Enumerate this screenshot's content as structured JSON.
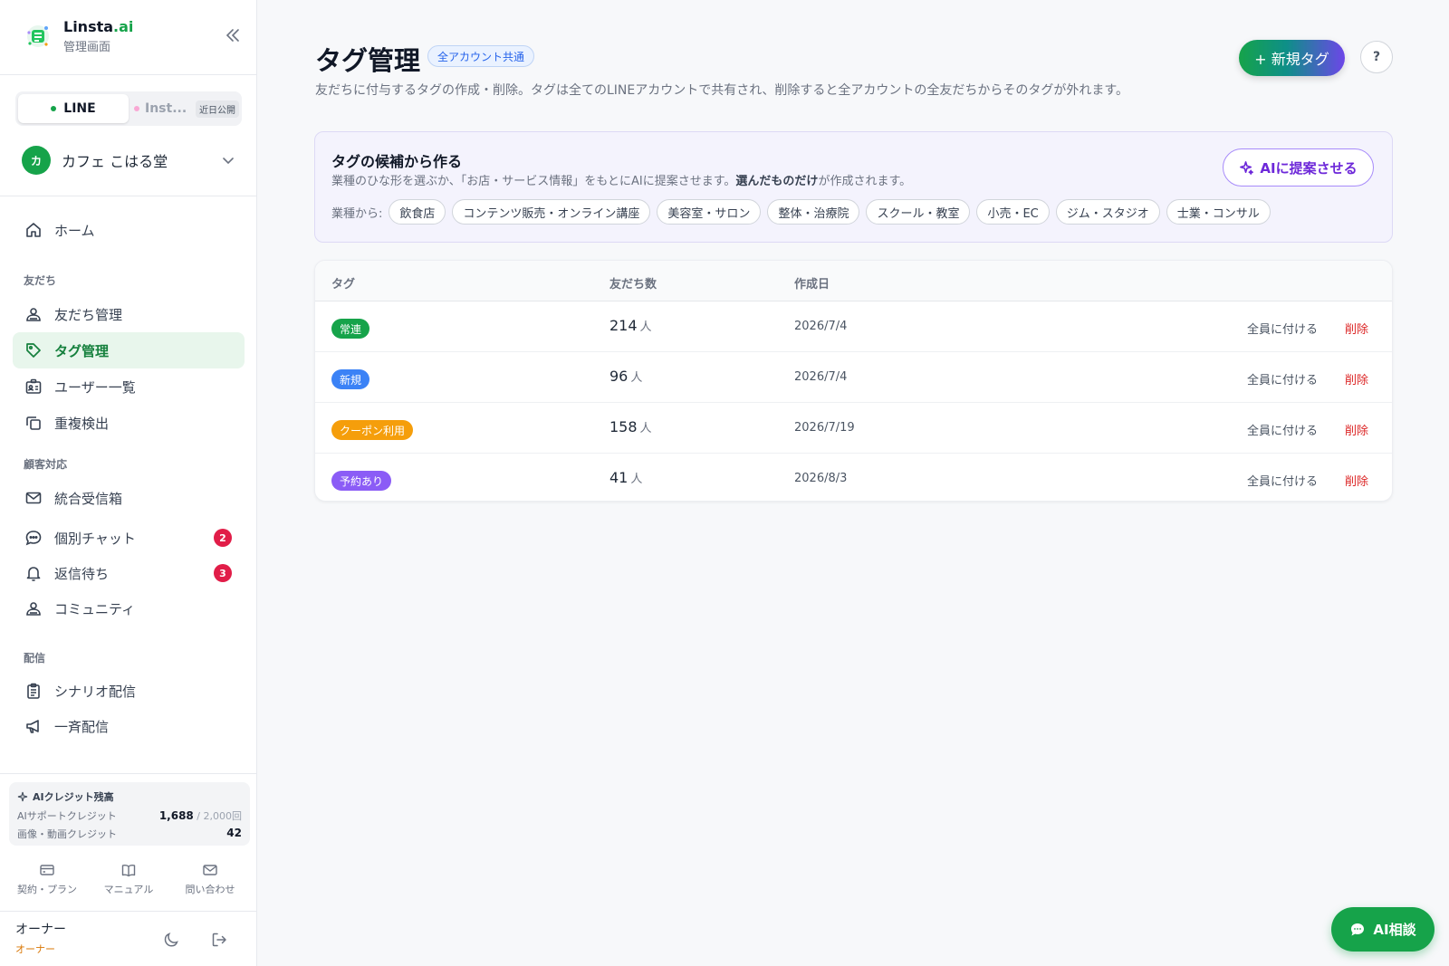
{
  "sidebar": {
    "brand": {
      "name_prefix": "Linsta",
      "name_suffix": ".ai",
      "subtitle": "管理画面"
    },
    "channels": [
      {
        "label": "LINE",
        "status_color": "#16a34a",
        "active": true
      },
      {
        "label": "Inst...",
        "status_color": "#f9a8d4",
        "badge": "近日公開"
      }
    ],
    "account": {
      "avatar": "カ",
      "name": "カフェ こはる堂"
    },
    "nav": {
      "home": "ホーム",
      "section_friends": "友だち",
      "friends_manage": "友だち管理",
      "tag_manage": "タグ管理",
      "user_list": "ユーザー一覧",
      "duplicate_detect": "重複検出",
      "section_support": "顧客対応",
      "unified_inbox": "統合受信箱",
      "private_chat": "個別チャット",
      "private_chat_badge": "2",
      "awaiting_reply": "返信待ち",
      "awaiting_reply_badge": "3",
      "community": "コミュニティ",
      "section_delivery": "配信",
      "scenario_delivery": "シナリオ配信",
      "broadcast": "一斉配信"
    },
    "credits": {
      "title": "AIクレジット残高",
      "support_label": "AIサポートクレジット",
      "support_value": "1,688",
      "support_max": "/ 2,000回",
      "media_label": "画像・動画クレジット",
      "media_value": "42"
    },
    "footer_links": {
      "plan": "契約・プラン",
      "manual": "マニュアル",
      "contact": "問い合わせ"
    },
    "owner": {
      "name": "オーナー",
      "role": "オーナー"
    }
  },
  "main": {
    "title": "タグ管理",
    "scope_badge": "全アカウント共通",
    "description": "友だちに付与するタグの作成・削除。タグは全てのLINEアカウントで共有され、削除すると全アカウントの全友だちからそのタグが外れます。",
    "new_tag_button": "+ 新規タグ",
    "help_button": "?",
    "suggest": {
      "title": "タグの候補から作る",
      "desc_before": "業種のひな形を選ぶか、「お店・サービス情報」をもとにAIに提案させます。",
      "desc_bold": "選んだものだけ",
      "desc_after": "が作成されます。",
      "ai_button": "AIに提案させる",
      "industry_label": "業種から:",
      "industries": [
        "飲食店",
        "コンテンツ販売・オンライン講座",
        "美容室・サロン",
        "整体・治療院",
        "スクール・教室",
        "小売・EC",
        "ジム・スタジオ",
        "士業・コンサル"
      ]
    },
    "table": {
      "headers": {
        "tag": "タグ",
        "count": "友だち数",
        "created": "作成日"
      },
      "rows": [
        {
          "tag": "常連",
          "color": "#16a34a",
          "count": "214",
          "unit": "人",
          "date": "2026/7/4",
          "assign": "全員に付ける",
          "delete": "削除"
        },
        {
          "tag": "新規",
          "color": "#3b82f6",
          "count": "96",
          "unit": "人",
          "date": "2026/7/4",
          "assign": "全員に付ける",
          "delete": "削除"
        },
        {
          "tag": "クーポン利用",
          "color": "#f59e0b",
          "count": "158",
          "unit": "人",
          "date": "2026/7/19",
          "assign": "全員に付ける",
          "delete": "削除"
        },
        {
          "tag": "予約あり",
          "color": "#8b5cf6",
          "count": "41",
          "unit": "人",
          "date": "2026/8/3",
          "assign": "全員に付ける",
          "delete": "削除"
        }
      ]
    },
    "ai_chat_button": "AI相談"
  }
}
